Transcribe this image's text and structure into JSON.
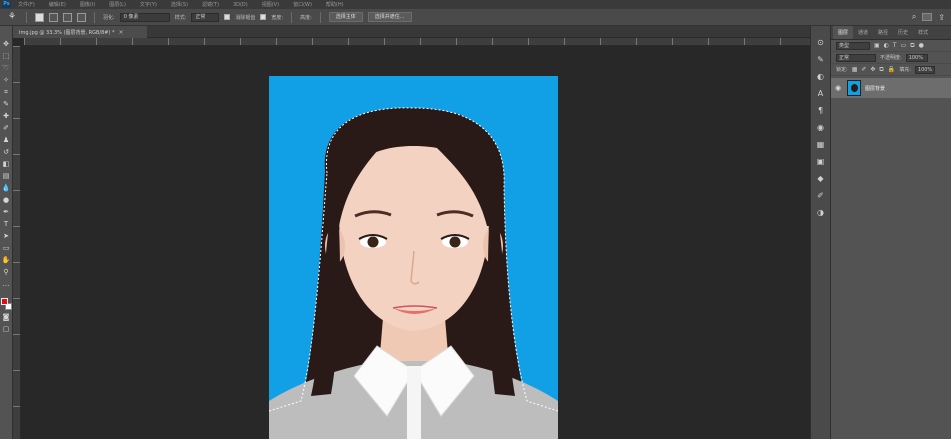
{
  "app": {
    "logo": "Ps"
  },
  "menu": [
    "文件(F)",
    "编辑(E)",
    "图像(I)",
    "图层(L)",
    "文字(Y)",
    "选择(S)",
    "滤镜(T)",
    "3D(D)",
    "视图(V)",
    "窗口(W)",
    "帮助(H)"
  ],
  "options": {
    "feather_label": "羽化:",
    "feather_value": "0 像素",
    "antialias_label": "消除锯齿",
    "style_label": "样式:",
    "style_value": "正常",
    "width_label": "宽度:",
    "height_label": "高度:",
    "select_subject": "选择主体",
    "select_and_mask": "选择并遮住..."
  },
  "document": {
    "tab_title": "Img.jpg @ 33.3% (图层背景, RGB/8#) *",
    "close": "×"
  },
  "panel": {
    "tabs": [
      "图层",
      "通道",
      "路径",
      "历史",
      "样式"
    ],
    "kind_label": "类型",
    "blend_mode": "正常",
    "opacity_label": "不透明度:",
    "opacity_value": "100%",
    "lock_label": "锁定:",
    "fill_label": "填充:",
    "fill_value": "100%",
    "layer_name": "图层背景"
  },
  "colors": {
    "photo_background": "#11a0e6",
    "foreground_swatch": "#e01010",
    "background_swatch": "#ffffff"
  }
}
